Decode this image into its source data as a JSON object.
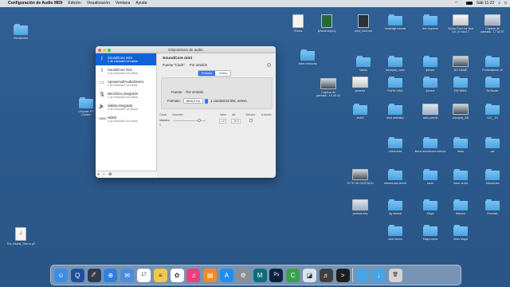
{
  "menubar": {
    "app_name": "Configuración de Audio MIDI",
    "menus": [
      "Edición",
      "Visualización",
      "Ventana",
      "Ayuda"
    ],
    "clock": "Sáb 11:22"
  },
  "window": {
    "title": "Dispositivos de audio",
    "devices": [
      {
        "name": "SoundCore mini",
        "sub": "2 de entrada/0 de salida",
        "icon": "bluetooth-icon"
      },
      {
        "name": "SoundCore mini",
        "sub": "0 de entrada/2 de salida",
        "icon": "bluetooth-icon"
      },
      {
        "name": "ApowersoftAudioDevice",
        "sub": "2 de entrada/2 de salida",
        "icon": "audio-device-icon"
      },
      {
        "name": "Micrófono integrado",
        "sub": "2 de entrada/0 de salida",
        "icon": "microphone-icon"
      },
      {
        "name": "Salida integrada",
        "sub": "0 de entrada/2 de salida",
        "icon": "speaker-icon"
      },
      {
        "name": "HDMI",
        "sub": "0 de entrada/2 de salida",
        "icon": "hdmi-icon"
      }
    ],
    "selected_device": "SoundCore mini",
    "clock_source_label": "Fuente \"Clock\":",
    "clock_source_value": "Por omisión",
    "tabs": [
      "Entrada",
      "Salida"
    ],
    "active_tab": "Entrada",
    "source_label": "Fuente:",
    "source_value": "Por omisión",
    "format_label": "Formato:",
    "format_value": "8000,0 Hz",
    "format_channels": "1 canales/16 bits, entero",
    "volume_headers": [
      "Canal",
      "Volumen",
      "Valor",
      "dB",
      "Silencio",
      "A través"
    ],
    "volume_rows": [
      {
        "channel": "Maestro",
        "value": "1,0",
        "db": "-10,0"
      },
      {
        "channel": "1",
        "value": "",
        "db": ""
      }
    ],
    "footer_buttons": [
      "+",
      "−",
      "⚙"
    ]
  },
  "desktop_left": [
    {
      "label": "Pendientes",
      "kind": "folder"
    },
    {
      "label": "Chrysler PT Cruiser",
      "kind": "folder"
    },
    {
      "label": "The_Bluest_Star.m p3",
      "kind": "file"
    }
  ],
  "desktop_grid": [
    {
      "label": "iTunes",
      "kind": "file"
    },
    {
      "label": "iphone.cmproj",
      "kind": "green"
    },
    {
      "label": "shot_new.ma",
      "kind": "dark"
    },
    {
      "label": "modelaje tutorial",
      "kind": "folder"
    },
    {
      "label": "iker imprimir",
      "kind": "folder"
    },
    {
      "label": "Cluido Form for Nue UV_Iit Nov17",
      "kind": "shot"
    },
    {
      "label": "Captura de pantalla...17.52.57",
      "kind": "shot"
    },
    {
      "label": "Varios",
      "kind": "folder"
    },
    {
      "label": "arbolpdy_color",
      "kind": "folder"
    },
    {
      "label": "iphone",
      "kind": "folder"
    },
    {
      "label": "NO NAME",
      "kind": "shot"
    },
    {
      "label": "Presentación v2",
      "kind": "folder"
    },
    {
      "label": "fotos verduras",
      "kind": "folder"
    },
    {
      "label": "Captura de pantalla...10.45.34",
      "kind": "shot"
    },
    {
      "label": "youtube",
      "kind": "shot"
    },
    {
      "label": "PURA VIDA",
      "kind": "folder"
    },
    {
      "label": "iphone",
      "kind": "folder"
    },
    {
      "label": "ESPAÑOL",
      "kind": "folder"
    },
    {
      "label": "3d Books",
      "kind": "folder"
    },
    {
      "label": "zb4r6",
      "kind": "folder"
    },
    {
      "label": "reed definitivo",
      "kind": "folder"
    },
    {
      "label": "work permit",
      "kind": "shot"
    },
    {
      "label": "arbolpdy_BN",
      "kind": "shot"
    },
    {
      "label": "122__01",
      "kind": "folder"
    },
    {
      "label": "references",
      "kind": "folder"
    },
    {
      "label": "libros animacion nuevos",
      "kind": "folder"
    },
    {
      "label": "fotos",
      "kind": "folder"
    },
    {
      "label": "cat",
      "kind": "folder"
    },
    {
      "label": "SI TE HA GUSTADO",
      "kind": "shot"
    },
    {
      "label": "referencias termS",
      "kind": "folder"
    },
    {
      "label": "luces",
      "kind": "folder"
    },
    {
      "label": "fotos venta",
      "kind": "folder"
    },
    {
      "label": "Difusiones",
      "kind": "folder"
    },
    {
      "label": "portada.key",
      "kind": "shot"
    },
    {
      "label": "rig tutorial",
      "kind": "folder"
    },
    {
      "label": "Maya",
      "kind": "folder"
    },
    {
      "label": "Hakuna",
      "kind": "folder"
    },
    {
      "label": "Recetas",
      "kind": "folder"
    },
    {
      "label": "shot nuevo",
      "kind": "folder"
    },
    {
      "label": "Maya copia",
      "kind": "folder"
    },
    {
      "label": "fotos Maya",
      "kind": "folder"
    }
  ],
  "dock_apps": [
    {
      "name": "finder-icon",
      "color": "#3b8ee6",
      "glyph": "☺"
    },
    {
      "name": "quicktime-icon",
      "color": "#1e4f9a",
      "glyph": "Q"
    },
    {
      "name": "launchpad-icon",
      "color": "#2d3b55",
      "glyph": "🚀"
    },
    {
      "name": "safari-icon",
      "color": "#2f7fe0",
      "glyph": "⊕"
    },
    {
      "name": "mail-icon",
      "color": "#4a8fdc",
      "glyph": "✉"
    },
    {
      "name": "calendar-icon",
      "color": "#ffffff",
      "glyph": "17"
    },
    {
      "name": "notes-icon",
      "color": "#f2c94c",
      "glyph": "≡"
    },
    {
      "name": "photos-icon",
      "color": "#ffffff",
      "glyph": "✿"
    },
    {
      "name": "itunes-icon",
      "color": "#e8417d",
      "glyph": "♫"
    },
    {
      "name": "ibooks-icon",
      "color": "#f08a24",
      "glyph": "▤"
    },
    {
      "name": "appstore-icon",
      "color": "#1f8ef1",
      "glyph": "A"
    },
    {
      "name": "system-preferences-icon",
      "color": "#8a8f96",
      "glyph": "⚙"
    },
    {
      "name": "maya-icon",
      "color": "#0b6e7a",
      "glyph": "M"
    },
    {
      "name": "photoshop-icon",
      "color": "#0c2340",
      "glyph": "Ps"
    },
    {
      "name": "camtasia-icon",
      "color": "#3aa14b",
      "glyph": "C"
    },
    {
      "name": "preview-icon",
      "color": "#d8e4f0",
      "glyph": "◪"
    },
    {
      "name": "audio-midi-icon",
      "color": "#3f3f3f",
      "glyph": "♬"
    },
    {
      "name": "terminal-icon",
      "color": "#1e1e1e",
      "glyph": ">"
    },
    {
      "name": "folder-icon",
      "color": "#4aa3e2",
      "glyph": ""
    },
    {
      "name": "downloads-icon",
      "color": "#4aa3e2",
      "glyph": "↓"
    },
    {
      "name": "trash-icon",
      "color": "#d4d4d4",
      "glyph": "🗑"
    }
  ]
}
